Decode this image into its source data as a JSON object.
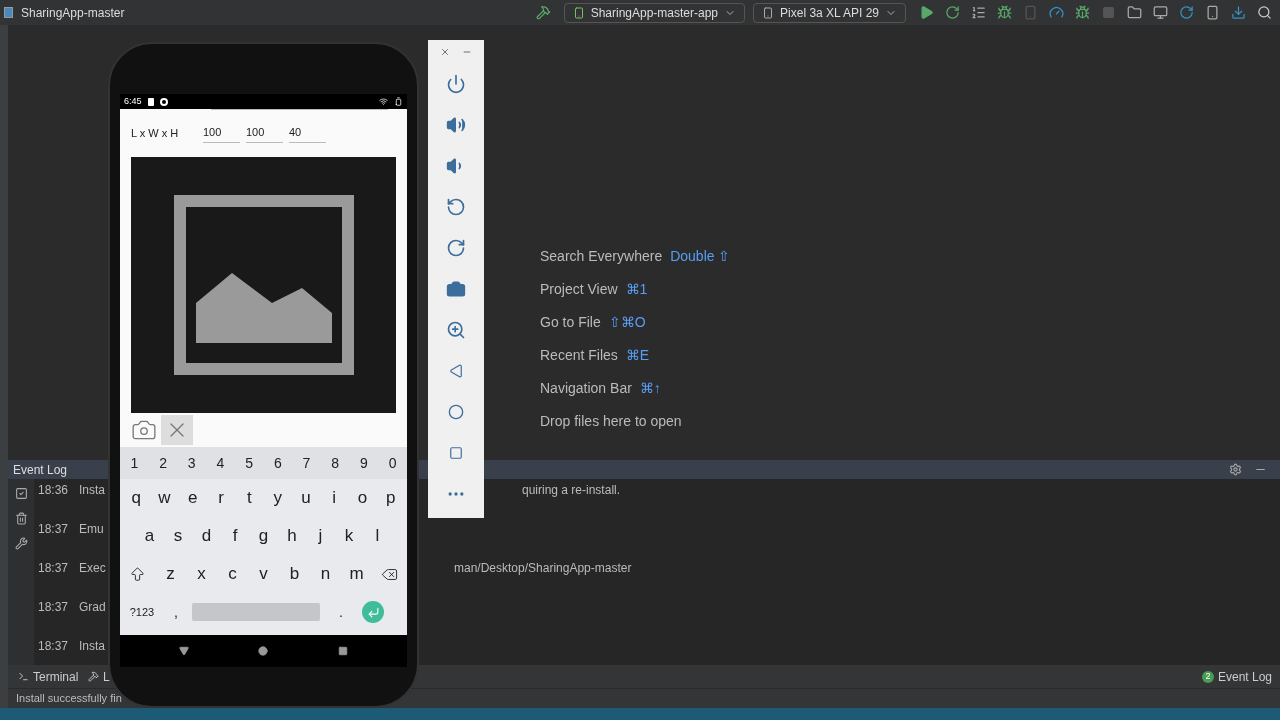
{
  "window": {
    "title": "SharingApp-master"
  },
  "toolbar": {
    "run_config": "SharingApp-master-app",
    "device": "Pixel 3a XL API 29"
  },
  "welcome_hints": [
    {
      "action": "Search Everywhere",
      "shortcut": "Double ⇧"
    },
    {
      "action": "Project View",
      "shortcut": "⌘1"
    },
    {
      "action": "Go to File",
      "shortcut": "⇧⌘O"
    },
    {
      "action": "Recent Files",
      "shortcut": "⌘E"
    },
    {
      "action": "Navigation Bar",
      "shortcut": "⌘↑"
    },
    {
      "action": "Drop files here to open"
    }
  ],
  "event_log": {
    "title": "Event Log",
    "rows": [
      {
        "time": "18:36",
        "message": "Insta",
        "tail": "quiring a re-install."
      },
      {
        "time": "18:37",
        "message": "Emu"
      },
      {
        "time": "18:37",
        "message": "Exec",
        "tail": "man/Desktop/SharingApp-master"
      },
      {
        "time": "18:37",
        "message": "Grad"
      },
      {
        "time": "18:37",
        "message": "Insta"
      }
    ]
  },
  "bottom_tabs": [
    "Terminal",
    "L"
  ],
  "status_bar": {
    "message": "Install successfully fin",
    "event_log_badge": "2",
    "event_log_label": "Event Log"
  },
  "phone": {
    "time": "6:45",
    "dimensions_label": "L x W x H",
    "dimension_fields": [
      "100",
      "100",
      "40"
    ],
    "keyboard": {
      "rows": [
        [
          "1",
          "2",
          "3",
          "4",
          "5",
          "6",
          "7",
          "8",
          "9",
          "0"
        ],
        [
          "q",
          "w",
          "e",
          "r",
          "t",
          "y",
          "u",
          "i",
          "o",
          "p"
        ],
        [
          "a",
          "s",
          "d",
          "f",
          "g",
          "h",
          "j",
          "k",
          "l"
        ],
        [
          "z",
          "x",
          "c",
          "v",
          "b",
          "n",
          "m"
        ]
      ],
      "symbols_key": "?123",
      "comma_key": ",",
      "period_key": "."
    }
  }
}
